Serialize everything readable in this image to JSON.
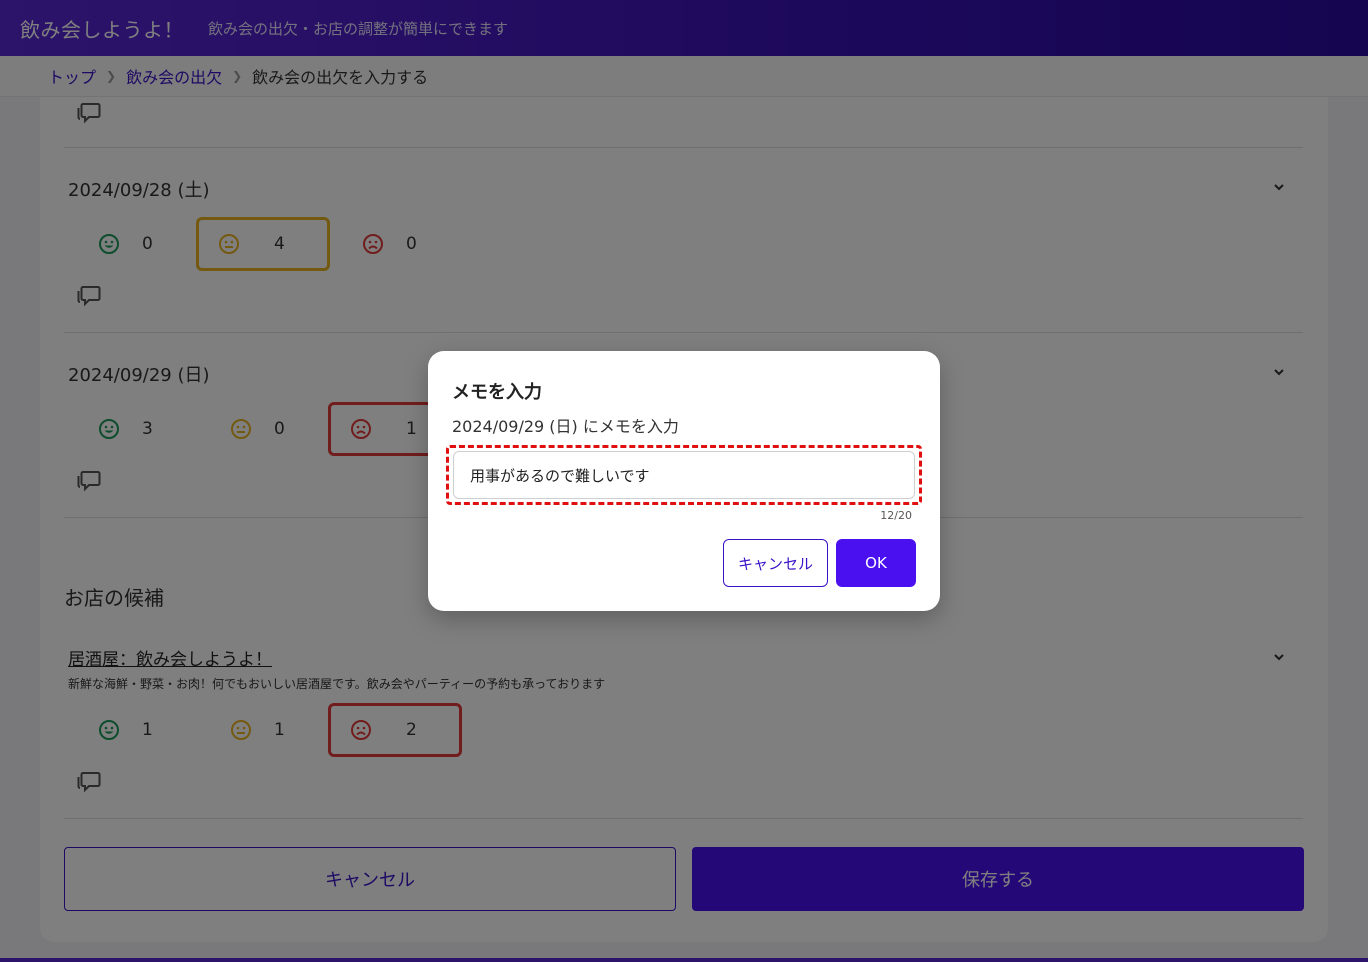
{
  "header": {
    "title": "飲み会しようよ！",
    "subtitle": "飲み会の出欠・お店の調整が簡単にできます"
  },
  "breadcrumb": {
    "items": [
      "トップ",
      "飲み会の出欠"
    ],
    "current": "飲み会の出欠を入力する"
  },
  "dates": [
    {
      "label": "2024/09/28 (土)",
      "counts": {
        "ok": "0",
        "maybe": "4",
        "no": "0"
      },
      "selected": "maybe"
    },
    {
      "label": "2024/09/29 (日)",
      "counts": {
        "ok": "3",
        "maybe": "0",
        "no": "1"
      },
      "selected": "no"
    }
  ],
  "shops": {
    "heading": "お店の候補",
    "items": [
      {
        "name": "居酒屋：飲み会しようよ！",
        "description": "新鮮な海鮮・野菜・お肉！何でもおいしい居酒屋です。飲み会やパーティーの予約も承っております",
        "counts": {
          "ok": "1",
          "maybe": "1",
          "no": "2"
        },
        "selected": "no"
      }
    ]
  },
  "actions": {
    "cancel_label": "キャンセル",
    "save_label": "保存する"
  },
  "dialog": {
    "title": "メモを入力",
    "subtitle": "2024/09/29 (日) にメモを入力",
    "input_value": "用事があるので難しいです",
    "counter": "12/20",
    "cancel_label": "キャンセル",
    "ok_label": "OK"
  },
  "colors": {
    "brand": "#4b10f0",
    "ok": "#1a9a5c",
    "maybe": "#e8b321",
    "no": "#e33b3b"
  }
}
